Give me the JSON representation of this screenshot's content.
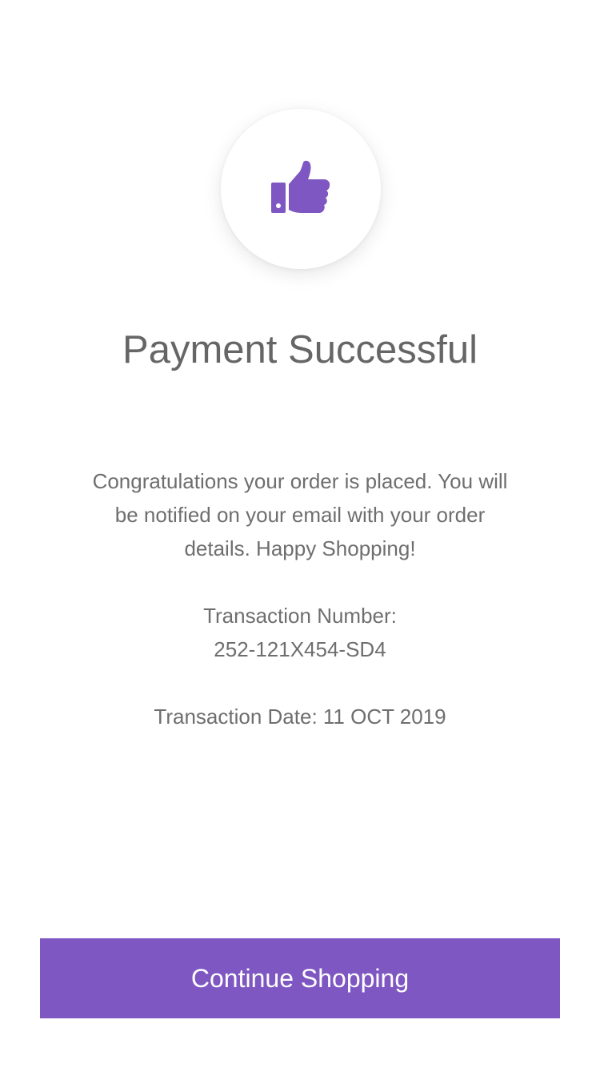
{
  "success_icon": {
    "name": "thumbs-up-icon",
    "color": "#7e57c2"
  },
  "title": "Payment Successful",
  "message": "Congratulations your order is placed. You will be notified on your email with your order details. Happy Shopping!",
  "transaction": {
    "number_label": "Transaction Number:",
    "number_value": "252-121X454-SD4",
    "date_text": "Transaction Date: 11 OCT 2019"
  },
  "continue_button": {
    "label": "Continue Shopping",
    "background": "#7e57c2"
  }
}
